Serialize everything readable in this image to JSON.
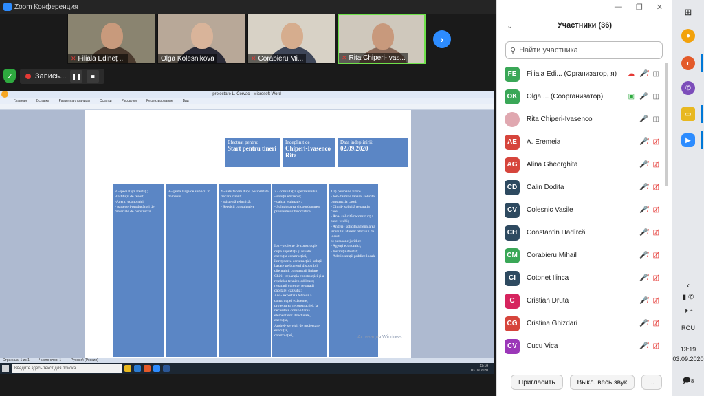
{
  "window": {
    "title": "Zoom Конференция"
  },
  "video_thumbnails": [
    {
      "name": "Filiala Edineț ...",
      "muted": true,
      "colors": {
        "bg": "#8a8470",
        "head": "#c89a7c",
        "body": "#4a3a2e"
      }
    },
    {
      "name": "Olga Kolesnikova",
      "muted": false,
      "colors": {
        "bg": "#b8a898",
        "head": "#d9b49a",
        "body": "#2a2a36"
      }
    },
    {
      "name": "Corabieru Mi...",
      "muted": true,
      "colors": {
        "bg": "#d8d2c6",
        "head": "#d6ad8e",
        "body": "#3e4658"
      }
    },
    {
      "name": "Rita Chiperi-Ivas...",
      "muted": true,
      "active": true,
      "colors": {
        "bg": "#cfc8bc",
        "head": "#c8997c",
        "body": "#8a6a5a"
      }
    }
  ],
  "recording": {
    "label": "Запись..."
  },
  "word": {
    "title": "proiectare L. Cervac - Microsoft Word",
    "menu": [
      "Главная",
      "Вставка",
      "Разметка страницы",
      "Ссылки",
      "Рассылки",
      "Рецензирование",
      "Вид"
    ],
    "status": [
      "Страница: 1 из 1",
      "Число слов: 1",
      "Русский (Россия)"
    ],
    "header_cells": [
      {
        "label": "Efectuat pentru:",
        "value": "Start pentru tineri"
      },
      {
        "label": "Indeplinit de",
        "value": "Chiperi-Ivasenco Rita"
      },
      {
        "label": "Data indeplinirii:",
        "value": "02.09.2020"
      }
    ],
    "columns": [
      {
        "top": "8 –specialiști atestați;\n-Instituții de resort;\n-Agenți economici;\n- parteneri-producători de materiale de construcții",
        "bottom": ""
      },
      {
        "top": "9 –gama largă de servicii în domeniu",
        "bottom": ""
      },
      {
        "top": "4 - satisfacem după posibilitate fiecare client;\n- asistență tehcnică;\n- Servicii consultative",
        "bottom": ""
      },
      {
        "top": "2 - consultația specialistului;\n- soluții eficiente;\n- calcul estimativ;\n- Soluționarea și coordonarea problemelor birocratice",
        "bottom": "Ion –proiecte de construcție după suprafață și nivele; execuția construcției, întreținerea construcției, soluții bazate pe bugetul disponibil clientului; construcții liniare\nChirii- reparația construcției și a rețelelor tehnico-edilitare; reparații curente, reparații capitale; cazeația;\nAna- expertiza tehnică a construcției existente, proiectarea reconstrucției, la necesitate consolidarea elementelor structurale, execuția,\nAndrei- servicii de proiectare, execuția,\nconstrucției,"
      },
      {
        "top": "1 a) persoane fizice\n- Ion- familie tânără, solicită construcția casei;\n- Chirii- solicită reparația casei ;\n- Ana- solicită reconstrucția casei vechi;\n- Andrei- solicită amenajarea terenului aferent blocului de locuit\nb) persoane juridice\n- Agenți economici;\n- Instituții de stat;\n- Administrații publice locale",
        "bottom": ""
      }
    ],
    "watermark": "Активация Windows",
    "taskbar_search": "Введите здесь текст для поиска",
    "taskbar_clock": "13:19",
    "taskbar_date": "03.09.2020"
  },
  "participants": {
    "title": "Участники (36)",
    "search_placeholder": "Найти участника",
    "list": [
      {
        "initials": "FE",
        "color": "#3aa757",
        "name": "Filiala Edi... (Организатор, я)",
        "mic": "off",
        "cam": "on",
        "rec": true
      },
      {
        "initials": "OK",
        "color": "#3aa757",
        "name": "Olga ... (Соорганизатор)",
        "mic": "on",
        "cam": "on",
        "share": true
      },
      {
        "initials": "",
        "color": "#e0a8b0",
        "name": "Rita Chiperi-Ivasenco",
        "mic": "on",
        "cam": "on",
        "photo": true
      },
      {
        "initials": "AE",
        "color": "#d6453c",
        "name": "A. Eremeia",
        "mic": "off",
        "cam": "off"
      },
      {
        "initials": "AG",
        "color": "#d6453c",
        "name": "Alina Gheorghita",
        "mic": "off",
        "cam": "off"
      },
      {
        "initials": "CD",
        "color": "#2e4a60",
        "name": "Calin Dodita",
        "mic": "off",
        "cam": "off"
      },
      {
        "initials": "CV",
        "color": "#2e4a60",
        "name": "Colesnic Vasile",
        "mic": "off",
        "cam": "off"
      },
      {
        "initials": "CH",
        "color": "#2e4a60",
        "name": "Constantin Hadîrcă",
        "mic": "off",
        "cam": "off"
      },
      {
        "initials": "CM",
        "color": "#3aa757",
        "name": "Corabieru Mihail",
        "mic": "off",
        "cam": "off"
      },
      {
        "initials": "CI",
        "color": "#2e4a60",
        "name": "Cotonet Ilinca",
        "mic": "off",
        "cam": "off"
      },
      {
        "initials": "C",
        "color": "#d6245e",
        "name": "Cristian Druta",
        "mic": "off",
        "cam": "off"
      },
      {
        "initials": "CG",
        "color": "#d6453c",
        "name": "Cristina Ghizdari",
        "mic": "off",
        "cam": "off"
      },
      {
        "initials": "CV",
        "color": "#9b37b8",
        "name": "Cucu Vica",
        "mic": "off",
        "cam": "off"
      }
    ],
    "invite_label": "Пригласить",
    "mute_all_label": "Выкл. весь звук",
    "more_label": "..."
  },
  "system": {
    "lang": "ROU",
    "time": "13:19",
    "date": "03.09.2020",
    "notifications": "8"
  }
}
